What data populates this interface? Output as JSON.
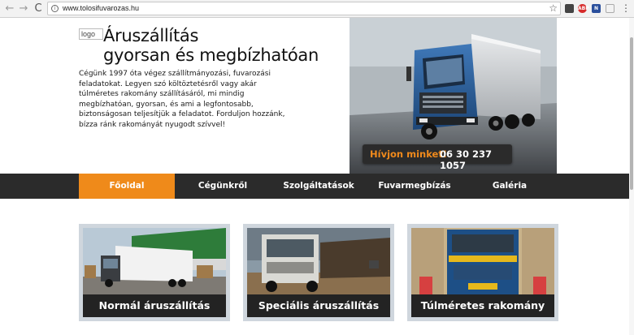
{
  "browser": {
    "url": "www.tolosifuvarozas.hu",
    "back_glyph": "←",
    "forward_glyph": "→",
    "reload_glyph": "C",
    "info_glyph": "i",
    "star_glyph": "☆",
    "menu_glyph": "⋮",
    "extensions": [
      {
        "icon": "bookmarks-icon",
        "label": ""
      },
      {
        "icon": "adblock-icon",
        "label": "ABP"
      },
      {
        "icon": "news-extension-icon",
        "label": "N"
      },
      {
        "icon": "extension-icon",
        "label": ""
      }
    ]
  },
  "hero": {
    "logo_alt": "logo",
    "title_line1": "Áruszállítás",
    "title_line2": "gyorsan és megbízhatóan",
    "intro": "Cégünk 1997 óta végez szállítmányozási, fuvarozási feladatokat. Legyen szó költöztetésről vagy akár túlméretes rakomány szállításáról, mi mindig megbízhatóan, gyorsan, és ami a legfontosabb, biztonságosan teljesítjük a feladatot. Forduljon hozzánk, bízza ránk rakományát nyugodt szívvel!",
    "call_label": "Hívjon minket!",
    "call_number": "06 30 237 1057"
  },
  "nav": {
    "items": [
      {
        "label": "Főoldal",
        "active": true
      },
      {
        "label": "Cégünkről",
        "active": false
      },
      {
        "label": "Szolgáltatások",
        "active": false
      },
      {
        "label": "Fuvarmegbízás",
        "active": false
      },
      {
        "label": "Galéria",
        "active": false
      }
    ]
  },
  "cards": [
    {
      "caption": "Normál áruszállítás"
    },
    {
      "caption": "Speciális áruszállítás"
    },
    {
      "caption": "Túlméretes rakomány"
    }
  ],
  "colors": {
    "accent": "#ef8a1a",
    "dark": "#2b2b2b",
    "card_frame": "#cfd6dd"
  }
}
